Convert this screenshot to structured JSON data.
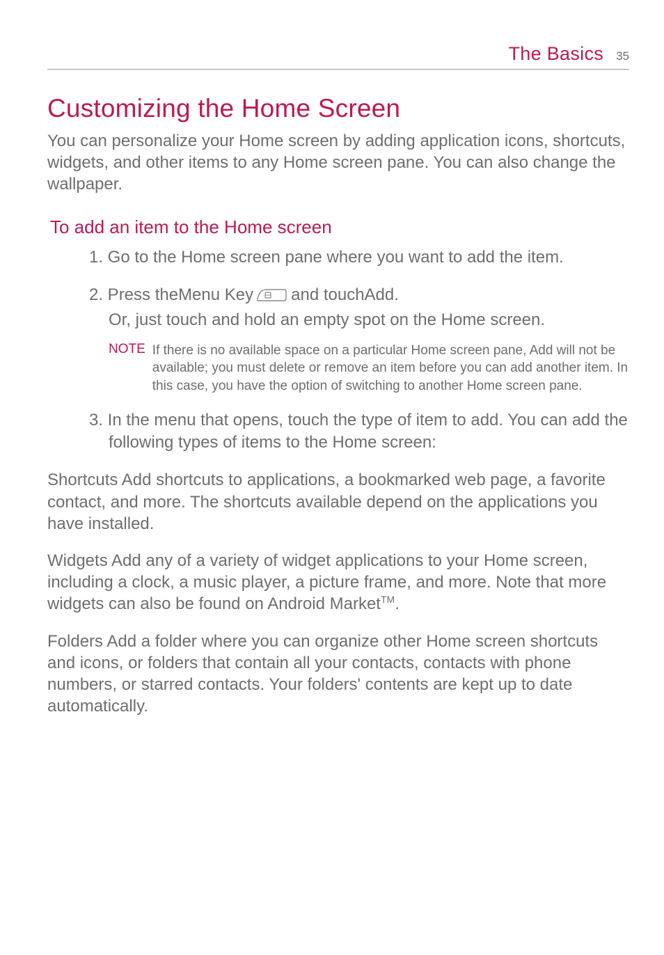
{
  "header": {
    "section_title": "The Basics",
    "page_number": "35"
  },
  "main_heading": "Customizing the Home Screen",
  "intro": "You can personalize your Home screen by adding application icons, shortcuts, widgets, and other items to any Home screen pane. You can also change the wallpaper.",
  "sub_heading": "To add an item to the Home screen",
  "steps": {
    "s1": "1. Go to the Home screen pane where you want to add the item.",
    "s2_a": "2. Press the ",
    "s2_key_label": "Menu Key",
    "s2_b": "  and touch ",
    "s2_add": "Add",
    "s2_c": ".",
    "s2_alt": "Or, just touch and hold an empty spot on the Home screen.",
    "s3": "3. In the menu that opens, touch the type of item to add. You can add the following types of items to the Home screen:"
  },
  "note": {
    "label": "NOTE",
    "text": "If there is no available space on a particular Home screen pane, Add will not be available; you must delete or remove an item before you can add another item. In this case, you have the option of switching to another Home screen pane."
  },
  "items": {
    "shortcuts_lead": "Shortcuts",
    "shortcuts_body": "  Add shortcuts to applications, a bookmarked web page, a favorite contact, and more. The shortcuts available depend on the applications you have installed.",
    "widgets_lead": "Widgets",
    "widgets_body_a": "  Add any of a variety of widget applications to your Home screen, including a clock, a music player, a picture frame, and more. Note that more widgets can also be found on Android Market",
    "widgets_tm": "TM",
    "widgets_body_b": ".",
    "folders_lead": "Folders",
    "folders_body": "  Add a folder where you can organize other Home screen shortcuts and icons, or folders that contain all your contacts, contacts with phone numbers, or starred contacts. Your folders' contents are kept up to date automatically."
  },
  "icons": {
    "menu_key": "menu-key-icon"
  }
}
